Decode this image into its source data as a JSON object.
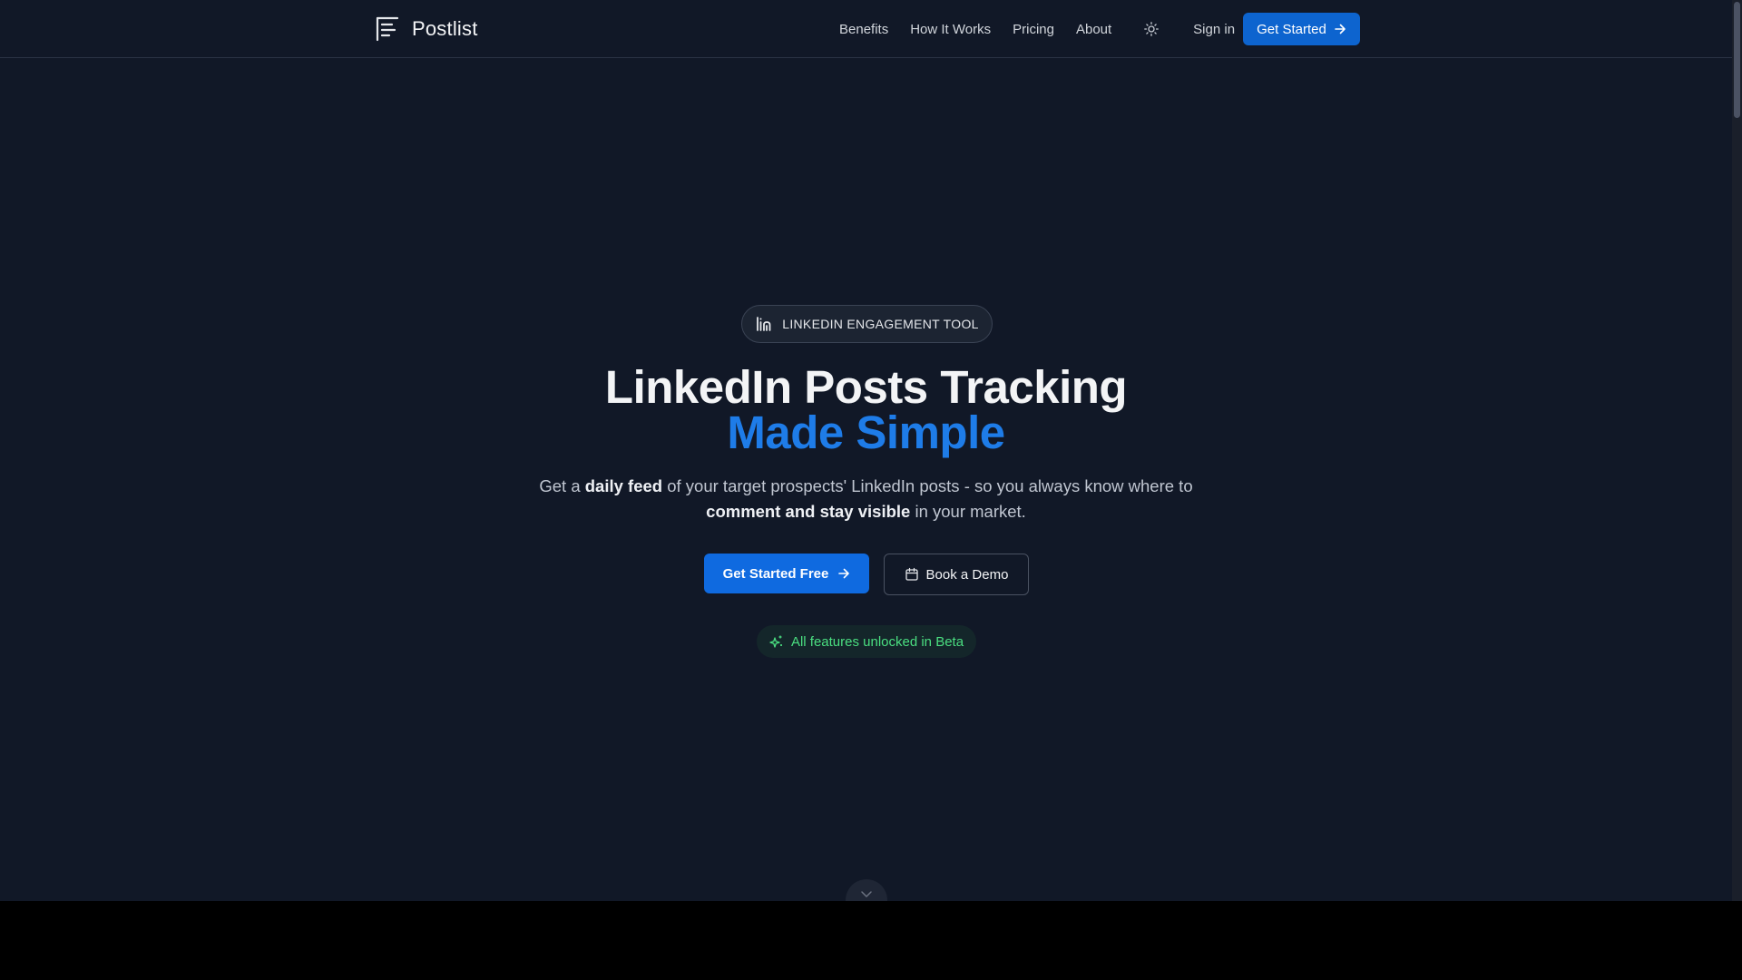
{
  "brand": {
    "name": "Postlist"
  },
  "nav": {
    "links": [
      "Benefits",
      "How It Works",
      "Pricing",
      "About"
    ],
    "sign_in": "Sign in",
    "cta": "Get Started"
  },
  "hero": {
    "badge": "LINKEDIN ENGAGEMENT TOOL",
    "title_line1": "LinkedIn Posts Tracking",
    "title_line2": "Made Simple",
    "subtitle": {
      "p1": "Get a ",
      "b1": "daily feed",
      "p2": " of your target prospects' LinkedIn posts - so you always know where to ",
      "b2": "comment and stay visible",
      "p3": " in your market."
    },
    "primary_cta": "Get Started Free",
    "secondary_cta": "Book a Demo",
    "beta_note": "All features unlocked in Beta"
  },
  "colors": {
    "background": "#111827",
    "accent": "#0f6ae0",
    "headline_accent": "#1e7ce8",
    "beta_green": "#4ade80"
  },
  "icons": [
    "postlist-logo-icon",
    "sun-icon",
    "arrow-right-icon",
    "linkedin-chart-icon",
    "calendar-icon",
    "sparkles-icon",
    "chevron-down-icon"
  ]
}
